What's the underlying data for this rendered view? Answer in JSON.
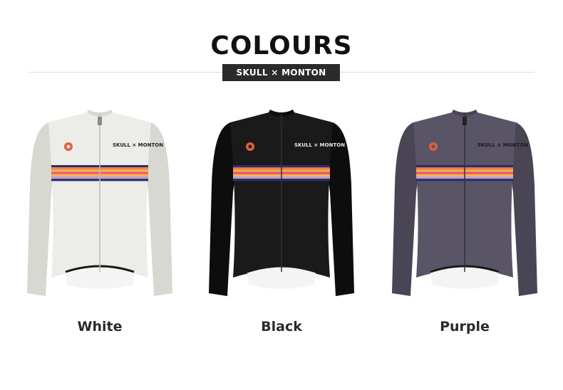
{
  "header": {
    "title": "COLOURS",
    "badge": "SKULL × MONTON"
  },
  "products": [
    {
      "name": "White",
      "body_color": "#ecece8",
      "shade_color": "#d8d8d2",
      "logo_color": "#222222"
    },
    {
      "name": "Black",
      "body_color": "#1a1a1a",
      "shade_color": "#0d0d0d",
      "logo_color": "#e8e8e8"
    },
    {
      "name": "Purple",
      "body_color": "#5a5566",
      "shade_color": "#4a4555",
      "logo_color": "#1a1a1a"
    }
  ],
  "jersey_logo_text": "SKULL × MONTON",
  "stripe_colors": [
    "#2b2f6b",
    "#ff7a4a",
    "#f0b24e",
    "#e85a7a",
    "#ffb14a",
    "#b8a3d8",
    "#2b2f6b"
  ]
}
